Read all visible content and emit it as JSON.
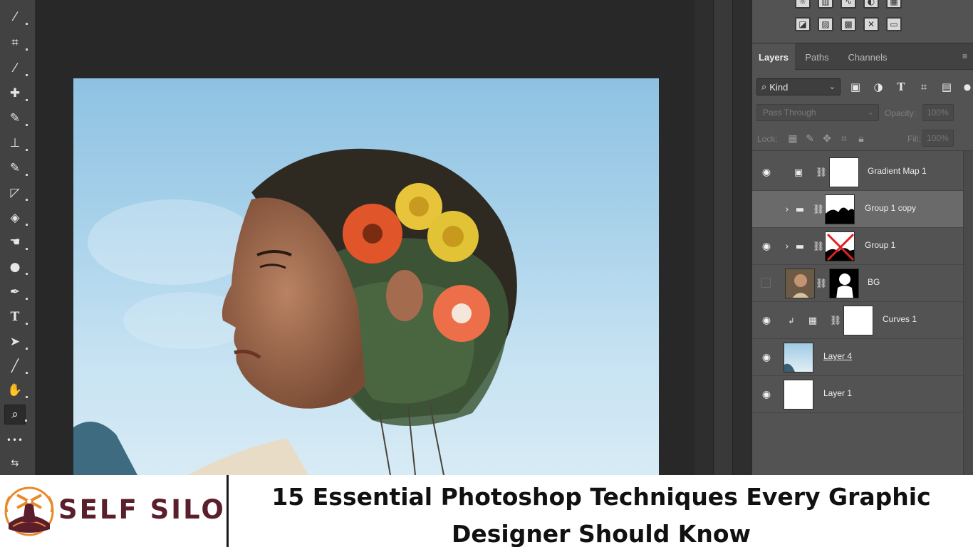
{
  "toolbar": {
    "tools": [
      {
        "name": "magic-wand-icon",
        "glyph": "⁄"
      },
      {
        "name": "crop-icon",
        "glyph": "⌗"
      },
      {
        "name": "eyedropper-icon",
        "glyph": "⁄"
      },
      {
        "name": "healing-brush-icon",
        "glyph": "✚"
      },
      {
        "name": "brush-icon",
        "glyph": "✎"
      },
      {
        "name": "clone-stamp-icon",
        "glyph": "⊥"
      },
      {
        "name": "history-brush-icon",
        "glyph": "✎"
      },
      {
        "name": "eraser-icon",
        "glyph": "◸"
      },
      {
        "name": "paint-bucket-icon",
        "glyph": "◈"
      },
      {
        "name": "smudge-icon",
        "glyph": "☚"
      },
      {
        "name": "dodge-icon",
        "glyph": "●"
      },
      {
        "name": "pen-icon",
        "glyph": "✒"
      },
      {
        "name": "type-icon",
        "glyph": "T"
      },
      {
        "name": "path-selection-icon",
        "glyph": "➤"
      },
      {
        "name": "line-icon",
        "glyph": "╱"
      },
      {
        "name": "hand-icon",
        "glyph": "✋"
      },
      {
        "name": "zoom-icon",
        "glyph": "⌕"
      },
      {
        "name": "more-tools-icon",
        "glyph": "•••"
      },
      {
        "name": "swap-colors-icon",
        "glyph": "⇆"
      }
    ]
  },
  "layers_panel": {
    "tabs": [
      {
        "label": "Layers",
        "active": true
      },
      {
        "label": "Paths",
        "active": false
      },
      {
        "label": "Channels",
        "active": false
      }
    ],
    "filter": {
      "kind_label": "Kind"
    },
    "blend_mode": "Pass Through",
    "opacity_label": "Opacity:",
    "opacity_value": "100%",
    "lock_label": "Lock:",
    "fill_label": "Fill:",
    "fill_value": "100%",
    "layers": [
      {
        "name": "Gradient Map 1",
        "visible": true,
        "selected": false,
        "underlined": false
      },
      {
        "name": "Group 1 copy",
        "visible": false,
        "selected": true,
        "underlined": false
      },
      {
        "name": "Group 1",
        "visible": true,
        "selected": false,
        "underlined": false
      },
      {
        "name": "BG",
        "visible": false,
        "selected": false,
        "underlined": false
      },
      {
        "name": "Curves 1",
        "visible": true,
        "selected": false,
        "underlined": false
      },
      {
        "name": "Layer 4",
        "visible": true,
        "selected": false,
        "underlined": true
      },
      {
        "name": "Layer 1",
        "visible": true,
        "selected": false,
        "underlined": false
      }
    ]
  },
  "banner": {
    "brand": "SELF SILO",
    "title": "15 Essential Photoshop Techniques Every Graphic Designer Should Know"
  },
  "colors": {
    "workspace_bg": "#282828",
    "panel_bg": "#535353",
    "brand": "#5a1e2d",
    "logo_accent": "#e88a2a"
  }
}
